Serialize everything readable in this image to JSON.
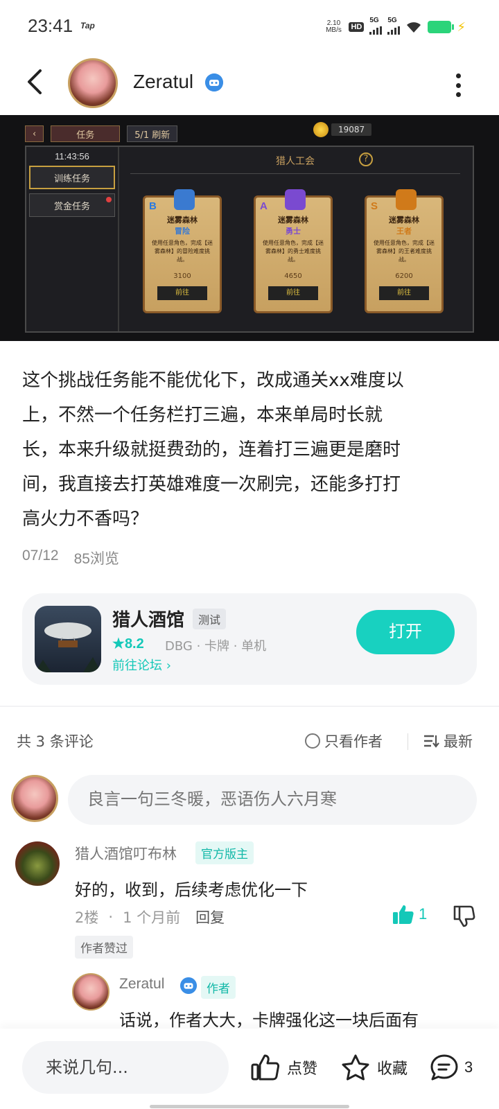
{
  "status_bar": {
    "time": "23:41",
    "tap": "Tap",
    "speed": "2.10",
    "speed_unit": "MB/s",
    "hd": "HD",
    "net1": "5G",
    "net2": "5G"
  },
  "header": {
    "author_name": "Zeratul"
  },
  "screenshot": {
    "tab_task": "任务",
    "refresh": "5/1 刷新",
    "gold": "19087",
    "timer": "11:43:56",
    "side_tabs": [
      "训练任务",
      "赏金任务"
    ],
    "guild": "猎人工会",
    "help": "?",
    "scrolls": [
      {
        "rank": "B",
        "title": "迷雾森林",
        "sub": "冒险",
        "desc": "使用任意角色，完成【迷雾森林】的冒险难度挑战。",
        "exp": "3100",
        "go": "前往",
        "color": "#3a7ad0"
      },
      {
        "rank": "A",
        "title": "迷雾森林",
        "sub": "勇士",
        "desc": "使用任意角色，完成【迷雾森林】的勇士难度挑战。",
        "exp": "4650",
        "go": "前往",
        "color": "#7a4ad0"
      },
      {
        "rank": "S",
        "title": "迷雾森林",
        "sub": "王者",
        "desc": "使用任意角色，完成【迷雾森林】的王者难度挑战。",
        "exp": "6200",
        "go": "前往",
        "color": "#d07a1a"
      }
    ]
  },
  "post": {
    "lines": [
      "这个挑战任务能不能优化下，改成通关xx难度以",
      "上，不然一个任务栏打三遍，本来单局时长就",
      "长，本来升级就挺费劲的，连着打三遍更是磨时",
      "间，我直接去打英雄难度一次刷完，还能多打打",
      "高火力不香吗？"
    ],
    "date": "07/12",
    "views": "85浏览"
  },
  "game_card": {
    "title": "猎人酒馆",
    "tag": "测试",
    "rating": "8.2",
    "categories": "DBG · 卡牌 · 单机",
    "forum_link": "前往论坛",
    "open_label": "打开"
  },
  "comments_header": {
    "count": "共 3 条评论",
    "only_author": "只看作者",
    "sort": "最新"
  },
  "comment_input": {
    "placeholder": "良言一句三冬暖，恶语伤人六月寒"
  },
  "comments": [
    {
      "name": "猎人酒馆叮布林",
      "badge": "官方版主",
      "text": "好的，收到，后续考虑优化一下",
      "floor": "2楼",
      "time": "1 个月前",
      "reply_label": "回复",
      "likes": "1",
      "liked_tag": "作者赞过"
    }
  ],
  "reply": {
    "name": "Zeratul",
    "badge": "作者",
    "text": "话说，作者大大，卡牌强化这一块后面有"
  },
  "bottom_bar": {
    "input_placeholder": "来说几句...",
    "like": "点赞",
    "favorite": "收藏",
    "comments": "3"
  },
  "colors": {
    "accent": "#18d1c0",
    "verify": "#3a8ee6"
  }
}
